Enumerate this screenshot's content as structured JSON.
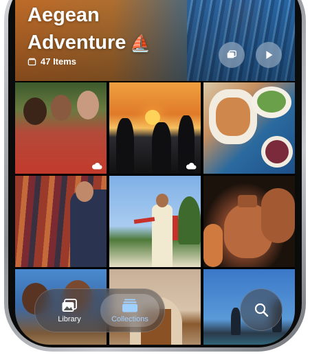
{
  "album": {
    "title_line1": "Aegean",
    "title_line2": "Adventure",
    "title_emoji": "⛵",
    "item_count": "47 Items"
  },
  "header_buttons": [
    {
      "name": "memories-icon"
    },
    {
      "name": "play-icon"
    }
  ],
  "tabs": [
    {
      "label": "Library",
      "icon": "photo-library-icon",
      "selected": false
    },
    {
      "label": "Collections",
      "icon": "collections-icon",
      "selected": true
    }
  ],
  "search": {
    "icon": "search-icon"
  },
  "colors": {
    "accent": "#9fd0ff"
  }
}
